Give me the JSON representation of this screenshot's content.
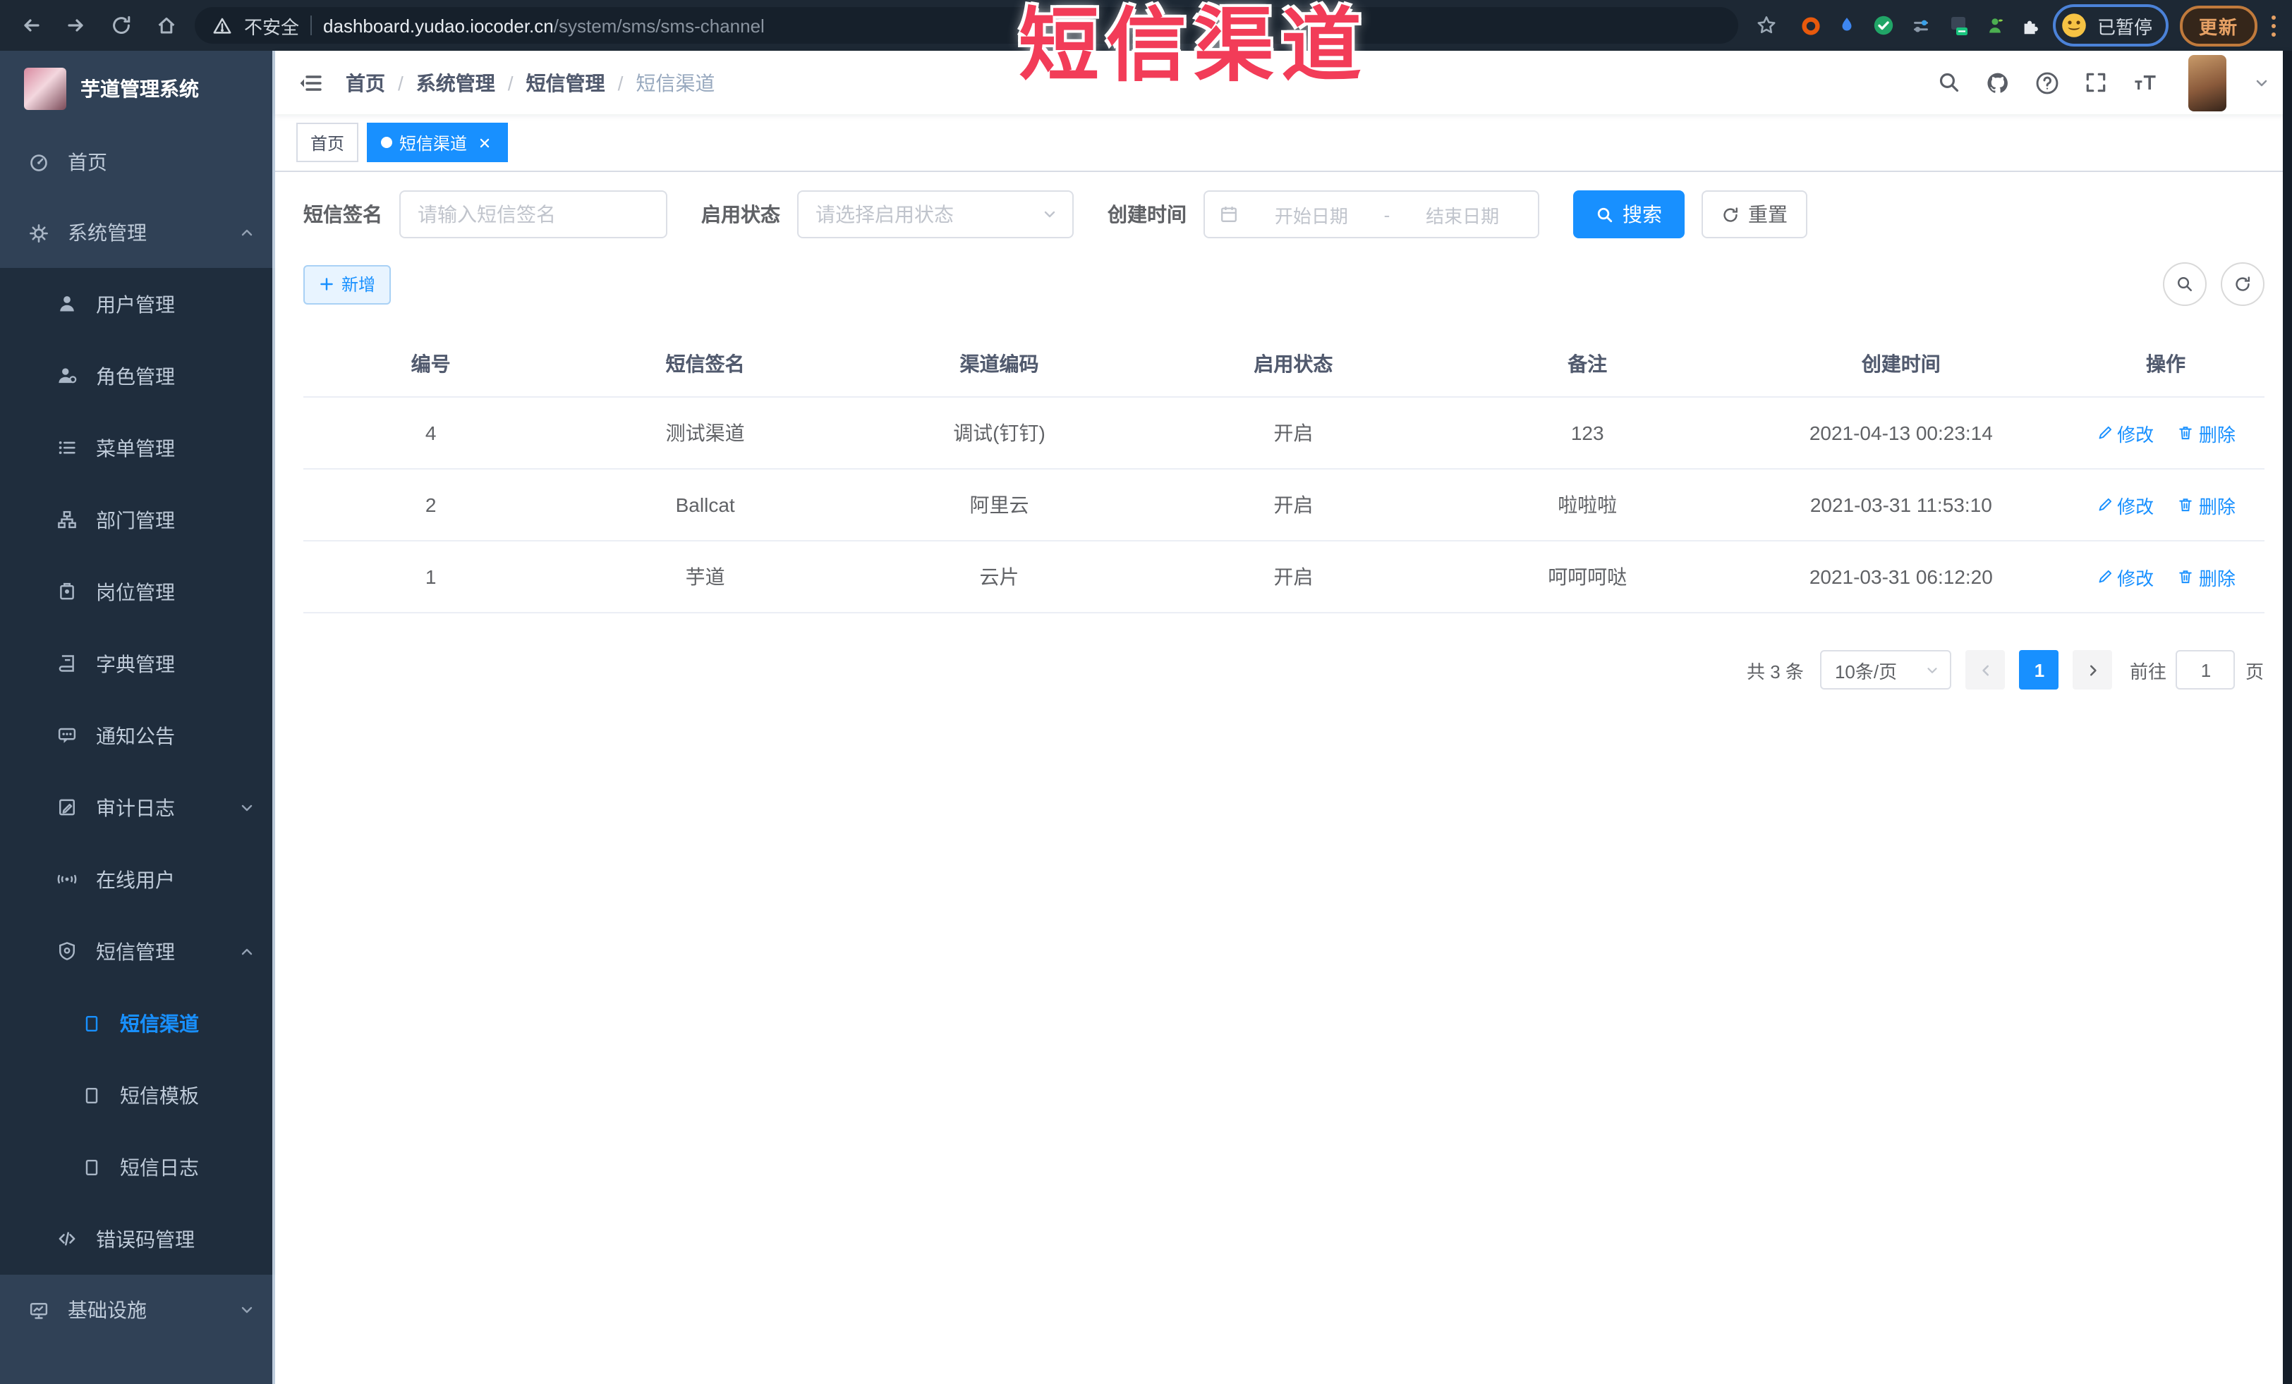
{
  "colors": {
    "accent": "#1890ff",
    "annotation_red": "#f23c58",
    "sidebar_bg": "#304156",
    "sidebar_submenu_bg": "#1f2d3d"
  },
  "annotation": {
    "text": "短信渠道"
  },
  "browser": {
    "security_label": "不安全",
    "url_host": "dashboard.yudao.iocoder.cn",
    "url_path": "/system/sms/sms-channel",
    "paused_label": "已暂停",
    "update_label": "更新"
  },
  "sidebar": {
    "logo_title": "芋道管理系统",
    "menu": [
      {
        "label": "首页",
        "icon": "dashboard-icon"
      },
      {
        "label": "系统管理",
        "icon": "gear-icon",
        "state": "expanded",
        "children": [
          {
            "label": "用户管理",
            "icon": "user-icon"
          },
          {
            "label": "角色管理",
            "icon": "role-icon"
          },
          {
            "label": "菜单管理",
            "icon": "menu-list-icon"
          },
          {
            "label": "部门管理",
            "icon": "org-tree-icon"
          },
          {
            "label": "岗位管理",
            "icon": "badge-icon"
          },
          {
            "label": "字典管理",
            "icon": "dictionary-icon"
          },
          {
            "label": "通知公告",
            "icon": "announcement-icon"
          },
          {
            "label": "审计日志",
            "icon": "audit-log-icon",
            "state": "collapsed"
          },
          {
            "label": "在线用户",
            "icon": "online-users-icon"
          },
          {
            "label": "短信管理",
            "icon": "sms-shield-icon",
            "state": "expanded",
            "children": [
              {
                "label": "短信渠道",
                "icon": "document-icon",
                "active": true
              },
              {
                "label": "短信模板",
                "icon": "document-icon"
              },
              {
                "label": "短信日志",
                "icon": "document-icon"
              }
            ]
          },
          {
            "label": "错误码管理",
            "icon": "code-icon"
          }
        ]
      },
      {
        "label": "基础设施",
        "icon": "monitor-icon",
        "state": "collapsed"
      }
    ]
  },
  "navbar": {
    "breadcrumb": [
      "首页",
      "系统管理",
      "短信管理",
      "短信渠道"
    ]
  },
  "tags_view": {
    "tags": [
      {
        "label": "首页",
        "active": false
      },
      {
        "label": "短信渠道",
        "active": true
      }
    ]
  },
  "filters": {
    "sign_label": "短信签名",
    "sign_placeholder": "请输入短信签名",
    "status_label": "启用状态",
    "status_placeholder": "请选择启用状态",
    "time_label": "创建时间",
    "start_placeholder": "开始日期",
    "range_separator": "-",
    "end_placeholder": "结束日期",
    "search_label": "搜索",
    "reset_label": "重置"
  },
  "toolbar": {
    "add_label": "新增"
  },
  "table": {
    "columns": [
      "编号",
      "短信签名",
      "渠道编码",
      "启用状态",
      "备注",
      "创建时间",
      "操作"
    ],
    "edit_label": "修改",
    "delete_label": "删除",
    "rows": [
      {
        "id": "4",
        "sign": "测试渠道",
        "code": "调试(钉钉)",
        "status": "开启",
        "remark": "123",
        "created": "2021-04-13 00:23:14"
      },
      {
        "id": "2",
        "sign": "Ballcat",
        "code": "阿里云",
        "status": "开启",
        "remark": "啦啦啦",
        "created": "2021-03-31 11:53:10"
      },
      {
        "id": "1",
        "sign": "芋道",
        "code": "云片",
        "status": "开启",
        "remark": "呵呵呵哒",
        "created": "2021-03-31 06:12:20"
      }
    ]
  },
  "pagination": {
    "total_label": "共 3 条",
    "page_size_value": "10条/页",
    "current_page": "1",
    "goto_label": "前往",
    "goto_value": "1",
    "page_unit_label": "页"
  }
}
